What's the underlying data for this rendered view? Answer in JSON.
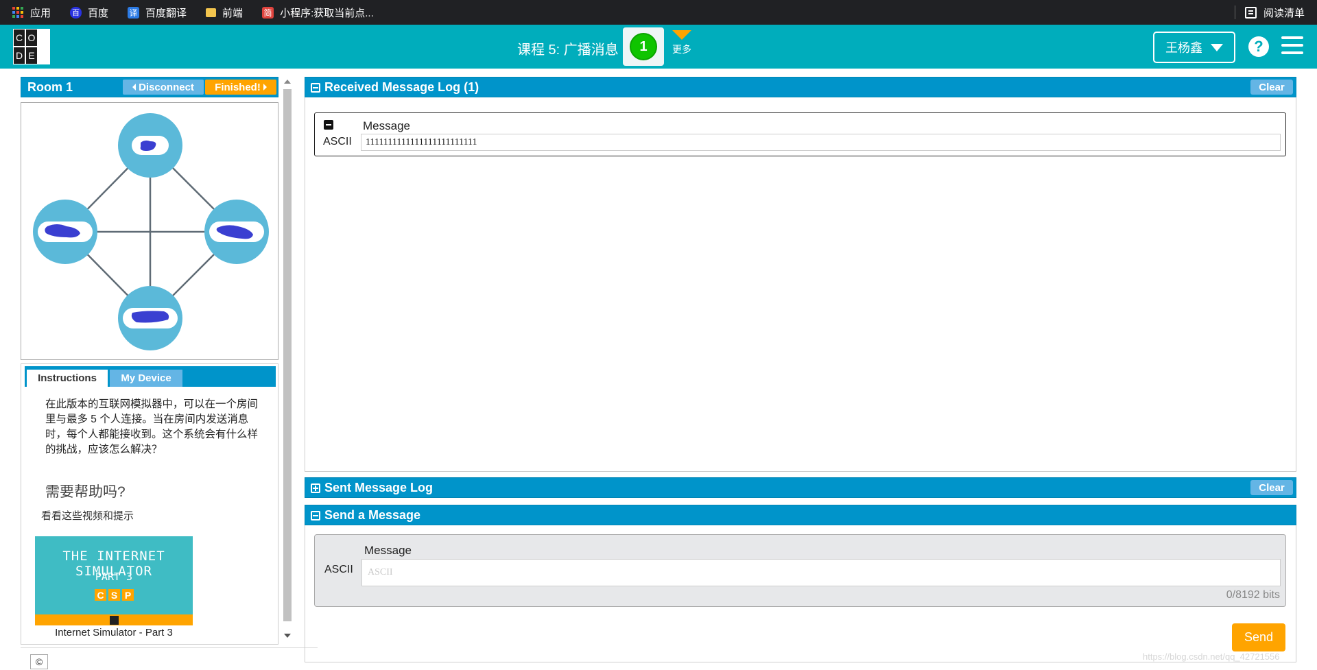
{
  "browser": {
    "bookmarks": [
      "应用",
      "百度",
      "百度翻译",
      "前端",
      "小程序:获取当前点..."
    ],
    "icons": {
      "baidu": "百",
      "fanyi": "译",
      "jian": "简"
    },
    "reading_list": "阅读清单"
  },
  "header": {
    "logo_letters": [
      "C",
      "O",
      "D",
      "E"
    ],
    "lesson_title": "课程 5: 广播消息",
    "progress_number": "1",
    "more_label": "更多",
    "user_name": "王杨鑫",
    "help_glyph": "?"
  },
  "room": {
    "title": "Room 1",
    "disconnect_label": "Disconnect",
    "finished_label": "Finished!"
  },
  "network": {
    "node_count": 4,
    "node_color": "#5bb9d9",
    "line_color": "#5f6b75",
    "scribble_color": "#3a3fd1"
  },
  "tabs": {
    "instructions": "Instructions",
    "device": "My Device"
  },
  "instructions": {
    "text": "在此版本的互联网模拟器中，可以在一个房间里与最多 5 个人连接。当在房间内发送消息时，每个人都能接收到。这个系统会有什么样的挑战，应该怎么解决？",
    "help_title": "需要帮助吗?",
    "help_sub": "看看这些视频和提示",
    "video_line1": "THE INTERNET SIMULATOR",
    "video_line2": "PART 3",
    "video_letters": [
      "C",
      "S",
      "P"
    ],
    "video_caption": "Internet Simulator - Part 3"
  },
  "received": {
    "title": "Received Message Log (1)",
    "clear_label": "Clear",
    "message_header": "Message",
    "format_label": "ASCII",
    "message_value": "1111111111111111111111111"
  },
  "sent": {
    "title": "Sent Message Log",
    "clear_label": "Clear"
  },
  "send": {
    "title": "Send a Message",
    "message_header": "Message",
    "format_label": "ASCII",
    "placeholder": "ASCII",
    "bits": "0/8192 bits",
    "send_label": "Send"
  },
  "footer": {
    "copyright": "©",
    "watermark": "https://blog.csdn.net/qq_42721556"
  },
  "colors": {
    "header": "#00adbc",
    "panel_bar": "#0094ca",
    "accent_orange": "#ffa400",
    "light_blue_button": "#64b5e5",
    "progress_green": "#0fc400"
  }
}
